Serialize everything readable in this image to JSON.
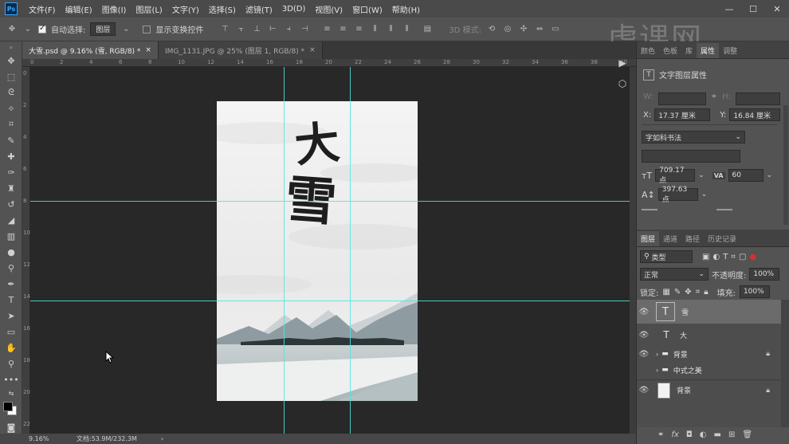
{
  "app": {
    "logo": "Ps"
  },
  "menu": [
    "文件(F)",
    "编辑(E)",
    "图像(I)",
    "图层(L)",
    "文字(Y)",
    "选择(S)",
    "滤镜(T)",
    "3D(D)",
    "视图(V)",
    "窗口(W)",
    "帮助(H)"
  ],
  "window_controls": {
    "minimize": "—",
    "maximize": "☐",
    "close": "✕"
  },
  "options_bar": {
    "auto_select_label": "自动选择:",
    "auto_select_value": "图层",
    "transform_controls_label": "显示变换控件",
    "mode_3d_label": "3D 模式:"
  },
  "tabs": [
    {
      "label": "大雪.psd @ 9.16% (雪, RGB/8) *",
      "close": "×"
    },
    {
      "label": "IMG_1131.JPG @ 25% (图层 1, RGB/8) *",
      "close": "×"
    }
  ],
  "rulers": {
    "top": [
      "0",
      "2",
      "4",
      "6",
      "8",
      "10",
      "12",
      "14",
      "16",
      "18",
      "20",
      "22",
      "24",
      "26",
      "28",
      "30",
      "32",
      "34",
      "36",
      "38",
      "40"
    ],
    "left": [
      "0",
      "2",
      "4",
      "6",
      "8",
      "10",
      "12",
      "14",
      "16",
      "18",
      "20",
      "22"
    ]
  },
  "poster": {
    "title_char_1": "大",
    "title_char_2": "雪",
    "accent": "#1e1e1e"
  },
  "status": {
    "zoom": "9.16%",
    "doc": "文档:53.9M/232.3M",
    "arrow": "›"
  },
  "properties": {
    "tabs": [
      "颜色",
      "色板",
      "库",
      "属性",
      "调整"
    ],
    "active_tab": "属性",
    "header": "文字图层属性",
    "w_label": "W:",
    "w_value": "",
    "h_label": "H:",
    "h_value": "",
    "x_label": "X:",
    "x_value": "17.37 厘米",
    "y_label": "Y:",
    "y_value": "16.84 厘米",
    "font_family": "字如科书法",
    "font_size": "709.17 点",
    "tracking_label": "VA",
    "tracking": "60",
    "leading": "397.63 点"
  },
  "layers_panel": {
    "tabs": [
      "图层",
      "通道",
      "路径",
      "历史记录"
    ],
    "filter_label": "类型",
    "blend_mode": "正常",
    "opacity_label": "不透明度:",
    "opacity": "100%",
    "lock_label": "锁定:",
    "fill_label": "填充:",
    "fill": "100%",
    "layers": [
      {
        "name": "雪",
        "type": "text",
        "selected": true
      },
      {
        "name": "大",
        "type": "text"
      },
      {
        "name": "背景",
        "type": "group",
        "locked": true
      },
      {
        "name": "中式之美",
        "type": "group",
        "hidden": true
      },
      {
        "name": "背景",
        "type": "image",
        "locked": true
      }
    ],
    "bottom_icons": [
      "link-icon",
      "fx-icon",
      "mask-icon",
      "adjustment-icon",
      "folder-icon",
      "new-layer-icon",
      "trash-icon"
    ]
  },
  "watermark": "虎课网"
}
